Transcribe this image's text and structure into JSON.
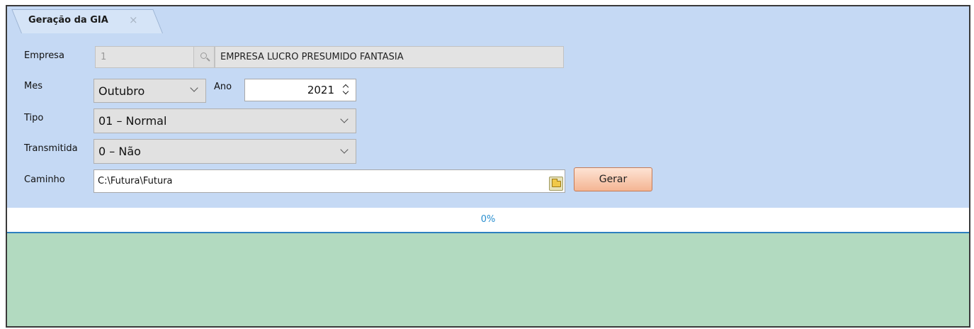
{
  "tab": {
    "title": "Geração da GIA",
    "close_icon": "×"
  },
  "form": {
    "empresa": {
      "label": "Empresa",
      "code": "1",
      "name": "EMPRESA LUCRO PRESUMIDO FANTASIA"
    },
    "mes": {
      "label": "Mes",
      "value": "Outubro"
    },
    "ano": {
      "label": "Ano",
      "value": "2021"
    },
    "tipo": {
      "label": "Tipo",
      "value": "01 – Normal"
    },
    "transmitida": {
      "label": "Transmitida",
      "value": "0 – Não"
    },
    "caminho": {
      "label": "Caminho",
      "value": "C:\\Futura\\Futura"
    }
  },
  "gerar_label": "Gerar",
  "progress": {
    "text": "0%",
    "value": 0
  },
  "icons": {
    "lookup": "magnifier-icon",
    "folder": "folder-icon",
    "select": "chevron-down-icon",
    "spinner": "spinner-arrows-icon"
  },
  "colors": {
    "panel_bg": "#c5d9f4",
    "log_bg": "#b2dac0",
    "progress_text": "#2a8fd0",
    "button_bg": "#f4b593"
  }
}
